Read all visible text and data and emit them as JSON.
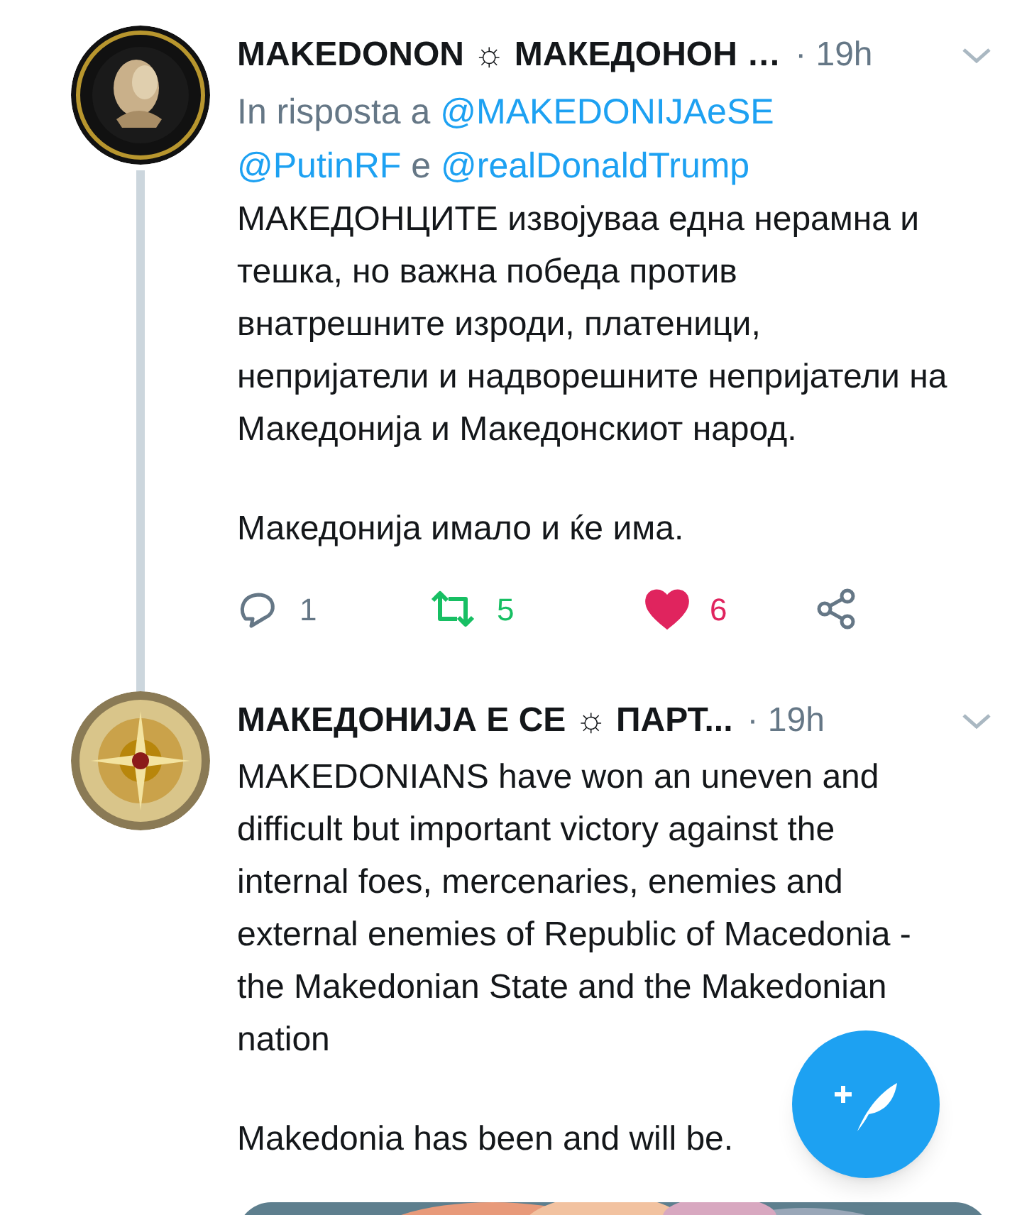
{
  "tweets": [
    {
      "name": "MAKEDONON ☼ МАКЕДОНОН …",
      "time": "· 19h",
      "reply_to": {
        "prefix": "In risposta a",
        "handles": [
          "@MAKEDONIJAeSE",
          "@PutinRF",
          "@realDonaldTrump"
        ],
        "joiner": "e"
      },
      "paragraphs": [
        "МАКЕДОНЦИТЕ извојуваа една нерамна и тешка, но важна победа против внатрешните изроди, платеници, непријатели и надворешните непријатели на Македонија и Македонскиот народ.",
        "Македонија имало и ќе има."
      ],
      "actions": {
        "replies": "1",
        "retweets": "5",
        "likes": "6",
        "retweeted": true,
        "liked": true
      },
      "thread_line": true
    },
    {
      "name": "МАКЕДОНИЈА Е СЕ ☼ ПАРТ...",
      "time": "· 19h",
      "paragraphs": [
        "MAKEDONIANS have won an uneven and difficult but important victory against the internal foes, mercenaries, enemies and external enemies of Republic of Macedonia - the Makedonian State and the Makedonian nation",
        "Makedonia has been and will be."
      ],
      "media": {
        "kind": "picture"
      },
      "thread_line": false
    }
  ]
}
